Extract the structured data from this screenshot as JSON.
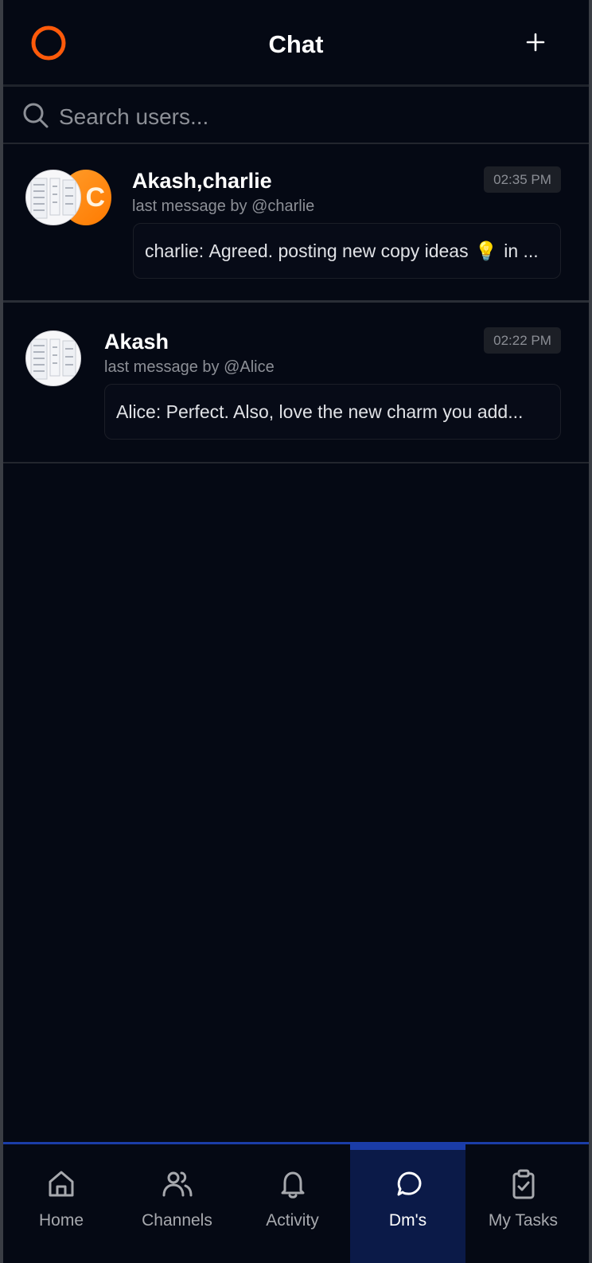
{
  "header": {
    "title": "Chat",
    "logo_icon": "ring-logo-icon",
    "add_icon": "plus-icon",
    "accent": "#ff5a0a"
  },
  "search": {
    "placeholder": "Search users...",
    "value": "",
    "icon": "search-icon"
  },
  "conversations": [
    {
      "name": "Akash,charlie",
      "last_by": "last message by @charlie",
      "time": "02:35 PM",
      "preview_author": "charlie:",
      "preview_text": "Agreed. posting new copy ideas",
      "preview_emoji": "💡",
      "preview_tail": "in ...",
      "avatar_letter": "C"
    },
    {
      "name": "Akash",
      "last_by": "last message by @Alice",
      "time": "02:22 PM",
      "preview_author": "Alice:",
      "preview_text": "Perfect. Also, love the new charm you add..."
    }
  ],
  "nav": {
    "items": [
      {
        "label": "Home",
        "icon": "home-icon"
      },
      {
        "label": "Channels",
        "icon": "users-icon"
      },
      {
        "label": "Activity",
        "icon": "bell-icon"
      },
      {
        "label": "Dm's",
        "icon": "chat-bubble-icon",
        "active": true
      },
      {
        "label": "My Tasks",
        "icon": "clipboard-check-icon"
      }
    ]
  }
}
